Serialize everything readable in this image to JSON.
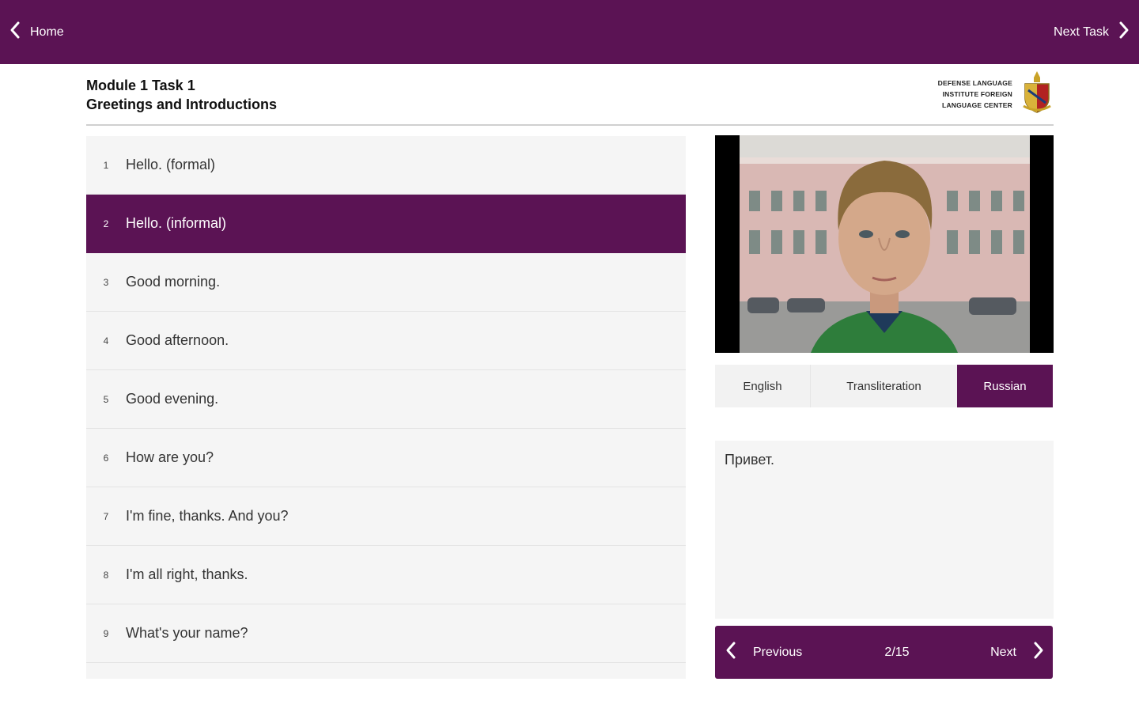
{
  "topbar": {
    "home_label": "Home",
    "next_task_label": "Next Task"
  },
  "header": {
    "module_task": "Module 1 Task 1",
    "title": "Greetings and Introductions",
    "logo_line1": "DEFENSE LANGUAGE",
    "logo_line2": "INSTITUTE FOREIGN",
    "logo_line3": "LANGUAGE CENTER"
  },
  "phrases": [
    {
      "num": "1",
      "text": "Hello. (formal)"
    },
    {
      "num": "2",
      "text": "Hello. (informal)"
    },
    {
      "num": "3",
      "text": "Good morning."
    },
    {
      "num": "4",
      "text": "Good afternoon."
    },
    {
      "num": "5",
      "text": "Good evening."
    },
    {
      "num": "6",
      "text": "How are you?"
    },
    {
      "num": "7",
      "text": "I'm fine, thanks. And you?"
    },
    {
      "num": "8",
      "text": "I'm all right, thanks."
    },
    {
      "num": "9",
      "text": "What's your name?"
    }
  ],
  "selected_phrase": "2",
  "language_tabs": {
    "english": "English",
    "transliteration": "Transliteration",
    "russian": "Russian",
    "selected": "Russian"
  },
  "translation_text": "Привет.",
  "pager": {
    "prev_label": "Previous",
    "count": "2/15",
    "next_label": "Next"
  },
  "colors": {
    "brand": "#5b1354",
    "panel": "#f5f5f5"
  }
}
